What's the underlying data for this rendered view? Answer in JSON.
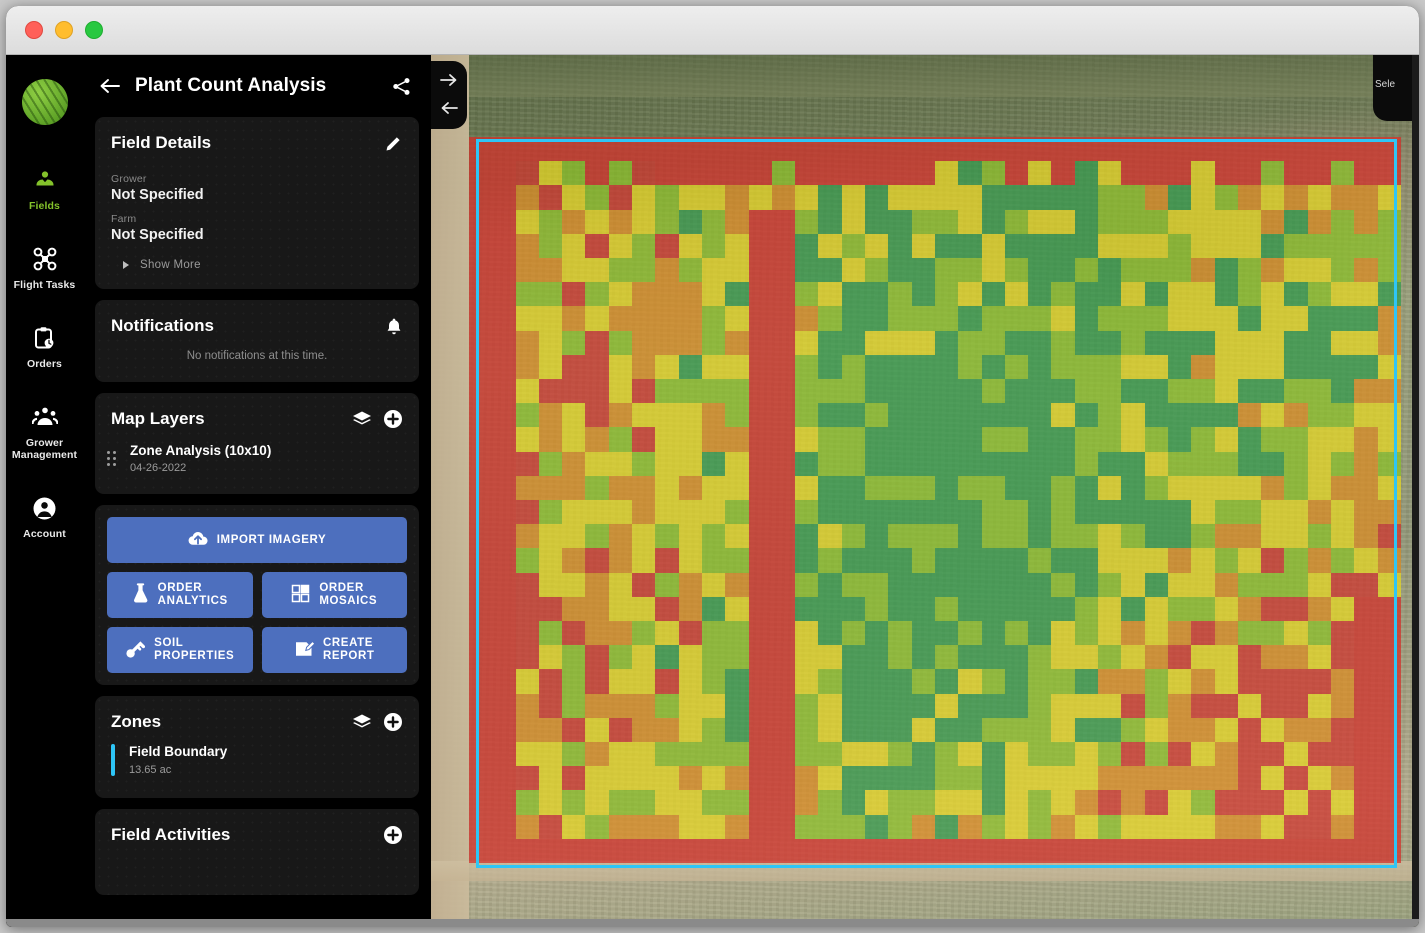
{
  "window": {
    "traffic_lights": [
      "close",
      "minimize",
      "maximize"
    ]
  },
  "rail": {
    "logo_name": "app-logo",
    "items": [
      {
        "label": "Fields",
        "icon": "fields-icon",
        "active": true
      },
      {
        "label": "Flight Tasks",
        "icon": "drone-icon",
        "active": false
      },
      {
        "label": "Orders",
        "icon": "clipboard-icon",
        "active": false
      },
      {
        "label": "Grower Management",
        "icon": "group-icon",
        "active": false
      },
      {
        "label": "Account",
        "icon": "account-icon",
        "active": false
      }
    ]
  },
  "panel": {
    "title": "Plant Count Analysis",
    "back_icon": "back-arrow-icon",
    "share_icon": "share-icon",
    "field_details": {
      "title": "Field Details",
      "edit_icon": "pencil-icon",
      "rows": [
        {
          "label": "Grower",
          "value": "Not Specified"
        },
        {
          "label": "Farm",
          "value": "Not Specified"
        }
      ],
      "show_more": "Show More"
    },
    "notifications": {
      "title": "Notifications",
      "bell_icon": "bell-icon",
      "empty_text": "No notifications at this time."
    },
    "map_layers": {
      "title": "Map Layers",
      "layers_icon": "layers-icon",
      "add_icon": "plus-circle-icon",
      "items": [
        {
          "name": "Zone Analysis (10x10)",
          "date": "04-26-2022",
          "grip_icon": "drag-handle-icon"
        }
      ]
    },
    "actions": {
      "import_imagery": {
        "label": "IMPORT IMAGERY",
        "icon": "cloud-upload-icon"
      },
      "order_analytics": {
        "label1": "ORDER",
        "label2": "ANALYTICS",
        "icon": "flask-icon"
      },
      "order_mosaics": {
        "label1": "ORDER",
        "label2": "MOSAICS",
        "icon": "mosaic-icon"
      },
      "soil_properties": {
        "label1": "SOIL",
        "label2": "PROPERTIES",
        "icon": "soil-probe-icon"
      },
      "create_report": {
        "label1": "CREATE",
        "label2": "REPORT",
        "icon": "report-icon"
      }
    },
    "zones": {
      "title": "Zones",
      "layers_icon": "layers-icon",
      "add_icon": "plus-circle-icon",
      "accent_color": "#2ec5f6",
      "items": [
        {
          "name": "Field Boundary",
          "area": "13.65 ac"
        }
      ]
    },
    "field_activities": {
      "title": "Field Activities",
      "add_icon": "plus-circle-icon"
    }
  },
  "map": {
    "controls": {
      "expand_right_icon": "arrow-right-icon",
      "collapse_left_icon": "arrow-left-icon"
    },
    "right_panel_label": "Sele",
    "boundary_color": "#2ec5f6",
    "zone_palette": {
      "red": "#d4302a",
      "orange": "#e08c1e",
      "yellow": "#ecdc1f",
      "light_green": "#8cc425",
      "green": "#2e9b4a"
    },
    "grid": {
      "cols": 40,
      "rows": 30,
      "label": "Zone Analysis (10x10)"
    }
  }
}
